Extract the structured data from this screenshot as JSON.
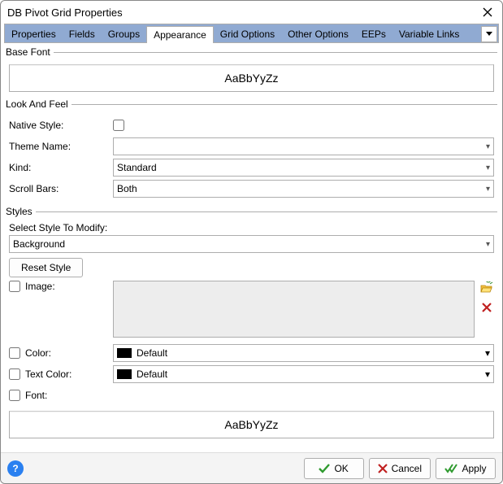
{
  "window": {
    "title": "DB Pivot Grid Properties"
  },
  "tabs": {
    "items": [
      {
        "label": "Properties"
      },
      {
        "label": "Fields"
      },
      {
        "label": "Groups"
      },
      {
        "label": "Appearance"
      },
      {
        "label": "Grid Options"
      },
      {
        "label": "Other Options"
      },
      {
        "label": "EEPs"
      },
      {
        "label": "Variable Links"
      }
    ],
    "active_index": 3
  },
  "baseFont": {
    "legend": "Base Font",
    "sample": "AaBbYyZz"
  },
  "lookAndFeel": {
    "legend": "Look And Feel",
    "nativeStyle": {
      "label": "Native Style:",
      "checked": false
    },
    "themeName": {
      "label": "Theme Name:",
      "value": ""
    },
    "kind": {
      "label": "Kind:",
      "value": "Standard"
    },
    "scrollBars": {
      "label": "Scroll Bars:",
      "value": "Both"
    }
  },
  "styles": {
    "legend": "Styles",
    "selectLabel": "Select Style To Modify:",
    "selectValue": "Background",
    "resetLabel": "Reset Style",
    "image": {
      "label": "Image:",
      "checked": false
    },
    "color": {
      "label": "Color:",
      "checked": false,
      "value": "Default"
    },
    "textColor": {
      "label": "Text Color:",
      "checked": false,
      "value": "Default"
    },
    "font": {
      "label": "Font:",
      "checked": false
    },
    "sample": "AaBbYyZz"
  },
  "footer": {
    "help": "?",
    "ok": "OK",
    "cancel": "Cancel",
    "apply": "Apply"
  }
}
